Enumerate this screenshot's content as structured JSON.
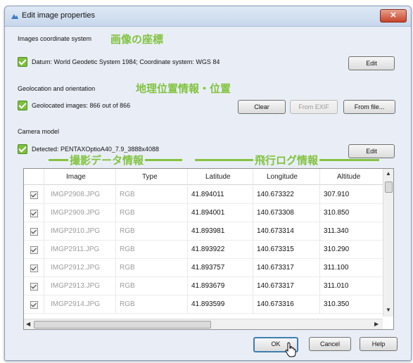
{
  "window": {
    "title": "Edit image properties",
    "close_glyph": "✕"
  },
  "coord": {
    "label": "Images coordinate system",
    "annotation_jp": "画像の座標",
    "datum_text": "Datum: World Geodetic System 1984; Coordinate system: WGS 84",
    "edit_label": "Edit"
  },
  "geo": {
    "label": "Geolocation and orientation",
    "annotation_jp": "地理位置情報・位置",
    "status_text": "Geolocated images: 866 out of 866",
    "clear_label": "Clear",
    "from_exif_label": "From EXIF",
    "from_file_label": "From file..."
  },
  "camera": {
    "label": "Camera model",
    "detected_text": "Detected: PENTAXOptioA40_7.9_3888x4088",
    "edit_label": "Edit"
  },
  "annotations": {
    "photo_data": "撮影データ情報",
    "flight_log": "飛行ログ情報"
  },
  "table": {
    "headers": [
      "Image",
      "Type",
      "Latitude",
      "Longitude",
      "Altitude"
    ],
    "rows": [
      {
        "image": "IMGP2908.JPG",
        "type": "RGB",
        "lat": "41.894011",
        "lon": "140.673322",
        "alt": "307.910"
      },
      {
        "image": "IMGP2909.JPG",
        "type": "RGB",
        "lat": "41.894001",
        "lon": "140.673308",
        "alt": "310.850"
      },
      {
        "image": "IMGP2910.JPG",
        "type": "RGB",
        "lat": "41.893981",
        "lon": "140.673314",
        "alt": "311.340"
      },
      {
        "image": "IMGP2911.JPG",
        "type": "RGB",
        "lat": "41.893922",
        "lon": "140.673315",
        "alt": "310.290"
      },
      {
        "image": "IMGP2912.JPG",
        "type": "RGB",
        "lat": "41.893757",
        "lon": "140.673317",
        "alt": "311.100"
      },
      {
        "image": "IMGP2913.JPG",
        "type": "RGB",
        "lat": "41.893679",
        "lon": "140.673317",
        "alt": "311.010"
      },
      {
        "image": "IMGP2914.JPG",
        "type": "RGB",
        "lat": "41.893599",
        "lon": "140.673316",
        "alt": "310.350"
      }
    ]
  },
  "footer": {
    "ok_label": "OK",
    "cancel_label": "Cancel",
    "help_label": "Help"
  },
  "colors": {
    "accent_green": "#82c341",
    "check_green": "#7fbf3f",
    "close_red": "#c7442a"
  }
}
